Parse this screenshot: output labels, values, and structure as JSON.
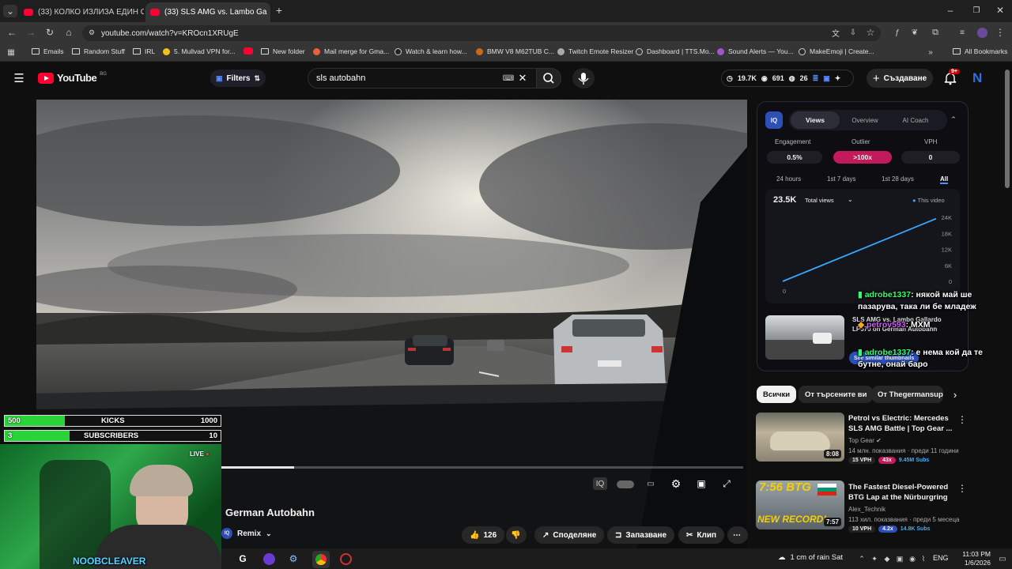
{
  "browser": {
    "tabs": [
      {
        "title": "(33) КОЛКО ИЗЛИЗА ЕДИН ОБ"
      },
      {
        "title": "(33) SLS AMG vs. Lambo Ga"
      }
    ],
    "url": "youtube.com/watch?v=KROcn1XRUgE",
    "bookmarks": [
      "Emails",
      "Random Stuff",
      "IRL",
      "5. Mullvad VPN for...",
      "New folder",
      "Mail merge for Gma...",
      "Watch & learn how...",
      "BMW V8 M62TUB C...",
      "Twitch Emote Resizer",
      "Dashboard | TTS.Mo...",
      "Sound Alerts — You...",
      "MakeEmoji | Create..."
    ],
    "all_bookmarks": "All Bookmarks"
  },
  "youtube": {
    "logo": "YouTube",
    "region": "BG",
    "filters": "Filters",
    "search_query": "sls autobahn",
    "stats": {
      "views": "19.7K",
      "videos": "691",
      "count": "26"
    },
    "create": "Създаване",
    "notifications": "9+",
    "avatar_letter": "N"
  },
  "video": {
    "title_fragment": "German Autobahn",
    "remix": "Remix",
    "likes": "126",
    "share": "Споделяне",
    "save": "Запазване",
    "clip": "Клип",
    "progress": 0.14
  },
  "vidiq": {
    "logo": "IQ",
    "tabs": [
      "Views",
      "Overview",
      "AI Coach"
    ],
    "metrics": [
      {
        "label": "Engagement",
        "value": "0.5%"
      },
      {
        "label": "Outlier",
        "value": ">100x"
      },
      {
        "label": "VPH",
        "value": "0"
      }
    ],
    "ranges": [
      "24 hours",
      "1st 7 days",
      "1st 28 days",
      "All"
    ],
    "total": "23.5K",
    "total_label": "Total views",
    "legend": "This video",
    "y_ticks": [
      "24K",
      "18K",
      "12K",
      "6K",
      "0"
    ],
    "x_tick": "0",
    "thumb_line": "SLS AMG vs. Lambo Gallardo",
    "thumb_line2": "LP570 on German Autobahn",
    "see_similar": "See similar thumbnails"
  },
  "chart_data": {
    "type": "line",
    "title": "",
    "series": [
      {
        "name": "This video",
        "x": [
          0,
          1
        ],
        "y": [
          0,
          23500
        ]
      }
    ],
    "ylim": [
      0,
      24000
    ],
    "ytick_labels": [
      "24K",
      "18K",
      "12K",
      "6K",
      "0"
    ],
    "xtick_labels": [
      "0"
    ],
    "legend": "top-right",
    "grid": false
  },
  "chips": [
    "Всички",
    "От търсените ви",
    "От Thegermansup"
  ],
  "recommendations": [
    {
      "title": "Petrol vs Electric: Mercedes SLS AMG Battle | Top Gear ...",
      "channel": "Top Gear",
      "meta": "14 млн. показвания · преди 11 години",
      "duration": "8:08",
      "vph": "15 VPH",
      "mult": "43x",
      "subs": "9.45M Subs"
    },
    {
      "title": "The Fastest Diesel-Powered BTG Lap at the Nürburgring",
      "channel": "Alex_Technik",
      "meta": "113 хил. показвания · преди 5 месеца",
      "duration": "7:57",
      "vph": "10 VPH",
      "mult": "4.2x",
      "subs": "14.8K Subs",
      "thumb_text": "7:56 BTG",
      "thumb_text2": "NEW RECORD!"
    }
  ],
  "chat": [
    {
      "user": "adrobe1337",
      "text": ": някой май ше пазарува, така ли бе младеж"
    },
    {
      "user": "petrov593",
      "text": ":"
    },
    {
      "user": "adrobe1337",
      "text": ": е нема кой да те бутне, онай баро"
    }
  ],
  "chat_extra": "MXM",
  "overlay": {
    "kicks_label": "KICKS",
    "kicks_current": "500",
    "kicks_goal": "1000",
    "kicks_fraction": 0.28,
    "subs_label": "SUBSCRIBERS",
    "subs_current": "3",
    "subs_goal": "10",
    "subs_fraction": 0.3,
    "live": "LIVE",
    "streamer": "NOOBCLEAVER"
  },
  "taskbar": {
    "weather": "1 cm of rain Sat",
    "lang": "ENG",
    "time": "11:03 PM",
    "date": "1/6/2026"
  }
}
